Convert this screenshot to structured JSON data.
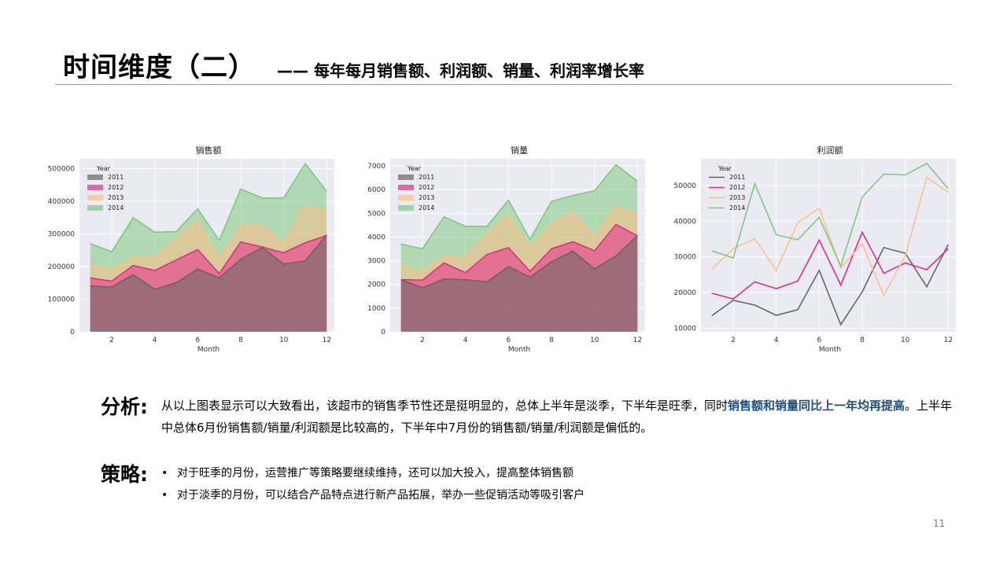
{
  "header": {
    "title": "时间维度（二）",
    "subtitle": "—— 每年每月销售额、利润额、销量、利润率增长率"
  },
  "analysis": {
    "label": "分析:",
    "text_part1": "从以上图表显示可以大致看出，该超市的销售季节性还是挺明显的，总体上半年是淡季，下半年是旺季，同时",
    "highlight": "销售额和销量同比上一年均再提高",
    "text_part2": "。上半年中总体6月份销售额/销量/利润额是比较高的，下半年中7月份的销售额/销量/利润额是偏低的。"
  },
  "strategy": {
    "label": "策略:",
    "bullet_glyph": "•",
    "items": [
      "对于旺季的月份，运营推广等策略要继续维持，还可以加大投入，提高整体销售额",
      "对于淡季的月份，可以结合产品特点进行新产品拓展，举办一些促销活动等吸引客户"
    ]
  },
  "page_number": "11",
  "colors": {
    "2011": "#666666",
    "2012": "#e7298a",
    "2013": "#fdc086",
    "2014": "#7fc97f",
    "plot_bg": "#eaeaf2",
    "highlight_text": "#1f4e79"
  },
  "chart_data": [
    {
      "type": "area",
      "title": "销售额",
      "xlabel": "Month",
      "ylabel": "",
      "legend_title": "Year",
      "legend_position": "top-left",
      "grid": true,
      "x": [
        1,
        2,
        3,
        4,
        5,
        6,
        7,
        8,
        9,
        10,
        11,
        12
      ],
      "xticks": [
        2,
        4,
        6,
        8,
        10,
        12
      ],
      "yticks": [
        0,
        100000,
        200000,
        300000,
        400000,
        500000
      ],
      "xlim": [
        0.5,
        12.5
      ],
      "ylim": [
        0,
        530000
      ],
      "series": [
        {
          "name": "2011",
          "values": [
            140000,
            137000,
            175000,
            130000,
            150000,
            192000,
            165000,
            222000,
            258000,
            207000,
            217000,
            297000
          ]
        },
        {
          "name": "2012",
          "values": [
            165000,
            155000,
            203000,
            188000,
            220000,
            252000,
            178000,
            275000,
            260000,
            242000,
            273000,
            295000
          ]
        },
        {
          "name": "2013",
          "values": [
            205000,
            190000,
            230000,
            232000,
            285000,
            343000,
            225000,
            325000,
            328000,
            273000,
            385000,
            375000
          ]
        },
        {
          "name": "2014",
          "values": [
            270000,
            245000,
            350000,
            305000,
            307000,
            377000,
            280000,
            437000,
            410000,
            410000,
            515000,
            430000
          ]
        }
      ]
    },
    {
      "type": "area",
      "title": "销量",
      "xlabel": "Month",
      "ylabel": "",
      "legend_title": "Year",
      "legend_position": "top-left",
      "grid": true,
      "x": [
        1,
        2,
        3,
        4,
        5,
        6,
        7,
        8,
        9,
        10,
        11,
        12
      ],
      "xticks": [
        2,
        4,
        6,
        8,
        10,
        12
      ],
      "yticks": [
        0,
        1000,
        2000,
        3000,
        4000,
        5000,
        6000,
        7000
      ],
      "xlim": [
        0.5,
        12.5
      ],
      "ylim": [
        0,
        7300
      ],
      "series": [
        {
          "name": "2011",
          "values": [
            2200,
            1850,
            2220,
            2200,
            2100,
            2750,
            2300,
            2950,
            3400,
            2650,
            3200,
            4050
          ]
        },
        {
          "name": "2012",
          "values": [
            2200,
            2180,
            2900,
            2500,
            3260,
            3550,
            2550,
            3500,
            3800,
            3420,
            4530,
            4050
          ]
        },
        {
          "name": "2013",
          "values": [
            2800,
            2550,
            3200,
            3200,
            4100,
            4950,
            3550,
            4550,
            5100,
            4000,
            5300,
            5000
          ]
        },
        {
          "name": "2014",
          "values": [
            3700,
            3500,
            4850,
            4450,
            4450,
            5550,
            3900,
            5500,
            5750,
            5950,
            7050,
            6350
          ]
        }
      ]
    },
    {
      "type": "line",
      "title": "利润额",
      "xlabel": "Month",
      "ylabel": "",
      "legend_title": "Year",
      "legend_position": "top-left",
      "grid": true,
      "x": [
        1,
        2,
        3,
        4,
        5,
        6,
        7,
        8,
        9,
        10,
        11,
        12
      ],
      "xticks": [
        2,
        4,
        6,
        8,
        10,
        12
      ],
      "yticks": [
        10000,
        20000,
        30000,
        40000,
        50000
      ],
      "xlim": [
        0.5,
        12.5
      ],
      "ylim": [
        9000,
        57500
      ],
      "series": [
        {
          "name": "2011",
          "values": [
            13500,
            17800,
            16500,
            13600,
            15200,
            26200,
            11000,
            20200,
            32600,
            31000,
            21600,
            33500
          ]
        },
        {
          "name": "2012",
          "values": [
            19800,
            18200,
            23000,
            21100,
            23200,
            34700,
            22100,
            36900,
            25400,
            28300,
            26400,
            32300
          ]
        },
        {
          "name": "2013",
          "values": [
            26500,
            32300,
            35100,
            26200,
            39500,
            43700,
            26900,
            33700,
            19200,
            30200,
            52300,
            48100
          ]
        },
        {
          "name": "2014",
          "values": [
            31700,
            29700,
            50500,
            36200,
            34800,
            41100,
            27400,
            46800,
            53200,
            53000,
            56200,
            49100
          ]
        }
      ]
    }
  ]
}
